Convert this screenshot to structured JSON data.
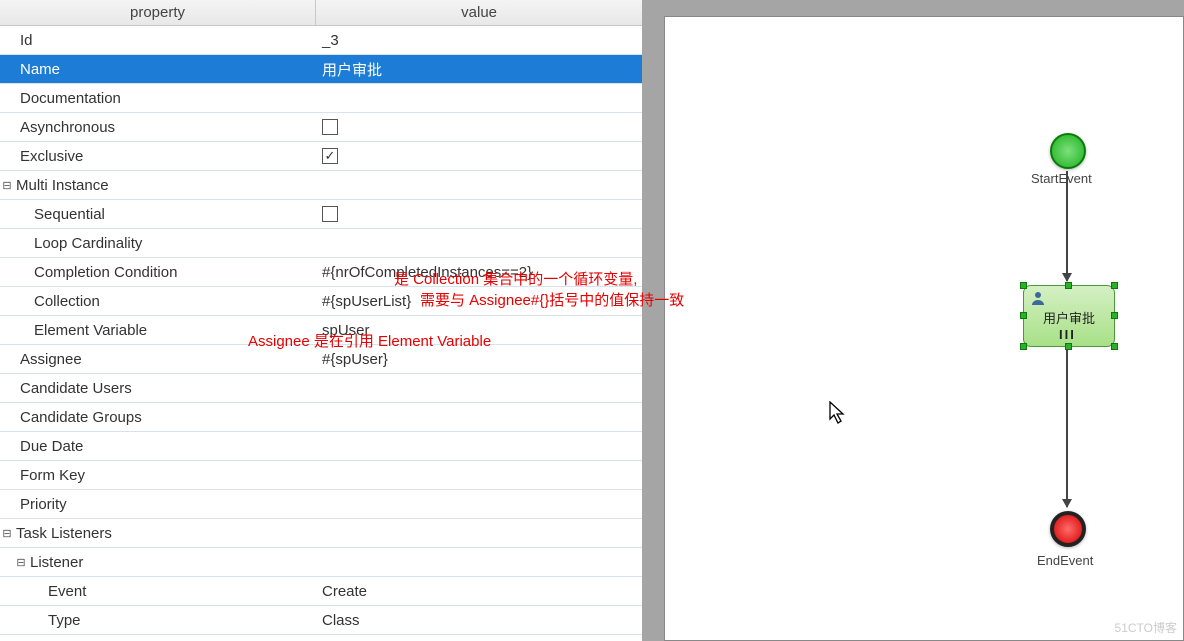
{
  "header": {
    "property": "property",
    "value": "value"
  },
  "rows": [
    {
      "k": "Id",
      "v": "_3",
      "ind": "ind0"
    },
    {
      "k": "Name",
      "v": "用户审批",
      "ind": "ind0",
      "sel": true
    },
    {
      "k": "Documentation",
      "v": "",
      "ind": "ind0"
    },
    {
      "k": "Asynchronous",
      "v": "",
      "ind": "ind0",
      "cb": true,
      "checked": false
    },
    {
      "k": "Exclusive",
      "v": "",
      "ind": "ind0",
      "cb": true,
      "checked": true
    },
    {
      "k": "Multi Instance",
      "v": "",
      "grp": "grp0",
      "tree": true
    },
    {
      "k": "Sequential",
      "v": "",
      "ind": "ind1",
      "cb": true,
      "checked": false
    },
    {
      "k": "Loop Cardinality",
      "v": "",
      "ind": "ind1"
    },
    {
      "k": "Completion Condition",
      "v": "#{nrOfCompletedInstances==2}",
      "ind": "ind1"
    },
    {
      "k": "Collection",
      "v": "#{spUserList}",
      "ind": "ind1"
    },
    {
      "k": "Element Variable",
      "v": "spUser",
      "ind": "ind1"
    },
    {
      "k": "Assignee",
      "v": "#{spUser}",
      "ind": "ind0"
    },
    {
      "k": "Candidate Users",
      "v": "",
      "ind": "ind0"
    },
    {
      "k": "Candidate Groups",
      "v": "",
      "ind": "ind0"
    },
    {
      "k": "Due Date",
      "v": "",
      "ind": "ind0"
    },
    {
      "k": "Form Key",
      "v": "",
      "ind": "ind0"
    },
    {
      "k": "Priority",
      "v": "",
      "ind": "ind0"
    },
    {
      "k": "Task Listeners",
      "v": "",
      "grp": "grp0",
      "tree": true
    },
    {
      "k": "Listener",
      "v": "",
      "grp": "grp1",
      "tree": true
    },
    {
      "k": "Event",
      "v": "Create",
      "ind": "ind2"
    },
    {
      "k": "Type",
      "v": "Class",
      "ind": "ind2"
    }
  ],
  "annotations": {
    "a1_line1": "是 Collection 集合中的一个循环变量,",
    "a1_line2": "需要与 Assignee#{}括号中的值保持一致",
    "a2": "Assignee 是在引用 Element Variable"
  },
  "diagram": {
    "start_label": "StartEvent",
    "task_label": "用户审批",
    "end_label": "EndEvent"
  },
  "watermark": "51CTO博客",
  "icons": {
    "check": "✓",
    "minus": "⊟"
  }
}
